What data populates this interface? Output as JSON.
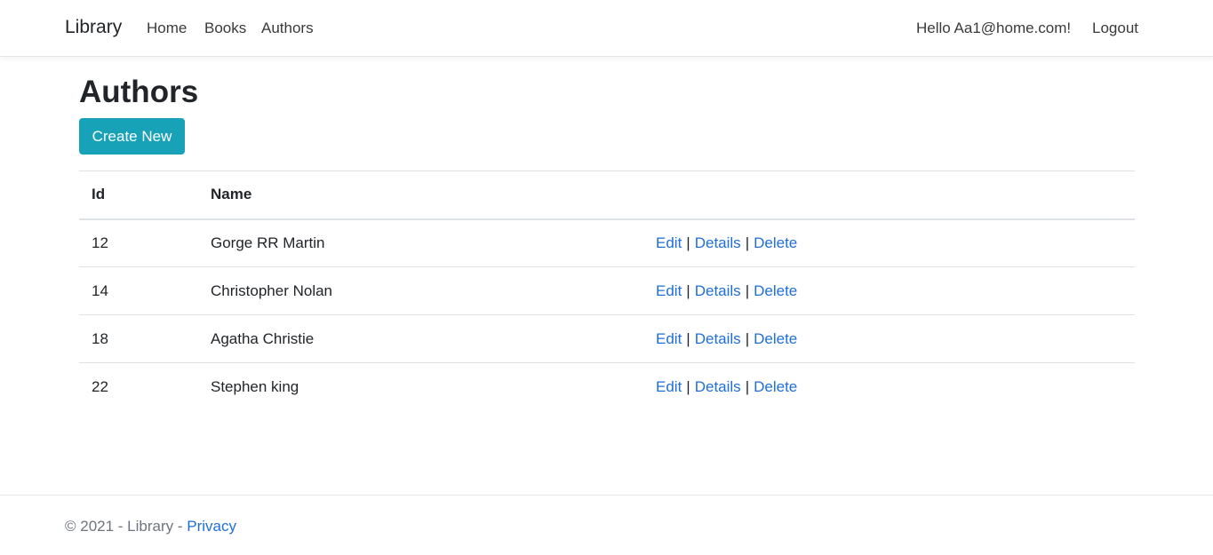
{
  "navbar": {
    "brand": "Library",
    "links": {
      "home": "Home",
      "books": "Books",
      "authors": "Authors"
    },
    "greeting": "Hello Aa1@home.com!",
    "logout": "Logout"
  },
  "main": {
    "title": "Authors",
    "create_button": "Create New",
    "table": {
      "headers": {
        "id": "Id",
        "name": "Name"
      },
      "rows": [
        {
          "id": "12",
          "name": "Gorge RR Martin"
        },
        {
          "id": "14",
          "name": "Christopher Nolan"
        },
        {
          "id": "18",
          "name": "Agatha Christie"
        },
        {
          "id": "22",
          "name": "Stephen king"
        }
      ],
      "actions": {
        "edit": "Edit",
        "details": "Details",
        "delete": "Delete",
        "separator": "|"
      }
    }
  },
  "footer": {
    "copyright": "© 2021 - Library - ",
    "privacy": "Privacy"
  },
  "colors": {
    "accent_button": "#17a2b8",
    "link": "#1e6fd9",
    "text": "#212529",
    "muted": "#6c757d"
  }
}
